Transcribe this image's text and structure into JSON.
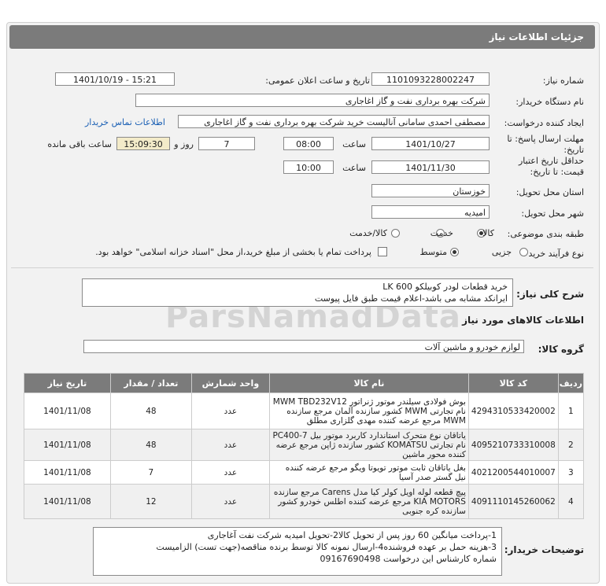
{
  "header": {
    "title": "جزئیات اطلاعات نیاز"
  },
  "fields": {
    "need_number_label": "شماره نیاز:",
    "need_number": "1101093228002247",
    "announce_label": "تاریخ و ساعت اعلان عمومی:",
    "announce_value": "1401/10/19 - 15:21",
    "buyer_label": "نام دستگاه خریدار:",
    "buyer_value": "شرکت بهره برداری نفت و گاز اغاجاری",
    "creator_label": "ایجاد کننده درخواست:",
    "creator_value": "مصطفی احمدی سامانی آنالیست خرید شرکت بهره برداری نفت و گاز اغاجاری",
    "contact_link": "اطلاعات تماس خریدار",
    "deadline_label_1": "مهلت ارسال پاسخ: تا",
    "deadline_label_2": "تاریخ:",
    "deadline_date": "1401/10/27",
    "time_label": "ساعت",
    "deadline_time": "08:00",
    "days_value": "7",
    "days_label": "روز و",
    "remaining_time": "15:09:30",
    "remaining_label": "ساعت باقی مانده",
    "validity_label_1": "حداقل تاریخ اعتبار",
    "validity_label_2": "قیمت: تا تاریخ:",
    "validity_date": "1401/11/30",
    "validity_time_label": "ساعت",
    "validity_time": "10:00",
    "province_label": "استان محل تحویل:",
    "province_value": "خوزستان",
    "city_label": "شهر محل تحویل:",
    "city_value": "امیدیه",
    "category_label": "طبقه بندی موضوعی:",
    "category_options": [
      "کالا",
      "خدمت",
      "کالا/خدمت"
    ],
    "process_label": "نوع فرآیند خرید :",
    "process_options": [
      "جزیی",
      "متوسط"
    ],
    "payment_note": "پرداخت تمام یا بخشی از مبلغ خرید،از محل \"اسناد خزانه اسلامی\" خواهد بود."
  },
  "summary": {
    "label": "شرح کلی نیاز:",
    "line1": "خرید قطعات لودر کوبیلکو LK 600",
    "line2": "ایرانکد مشابه می باشد-اعلام قیمت طبق فایل پیوست"
  },
  "goods_info_title": "اطلاعات کالاهای مورد نیاز",
  "goods_group": {
    "label": "گروه کالا:",
    "value": "لوازم خودرو و ماشین آلات"
  },
  "table": {
    "headers": [
      "ردیف",
      "کد کالا",
      "نام کالا",
      "واحد شمارش",
      "تعداد / مقدار",
      "تاریخ نیاز"
    ],
    "rows": [
      {
        "row": "1",
        "code": "4294310533420002",
        "name": "بوش فولادی سیلندر موتور ژنراتور MWM TBD232V12 نام تجارتی MWM کشور سازنده آلمان مرجع سازنده MWM مرجع عرضه کننده مهدی گلزاری مطلق",
        "unit": "عدد",
        "qty": "48",
        "date": "1401/11/08"
      },
      {
        "row": "2",
        "code": "4095210733310008",
        "name": "یاتاقان نوع متحرک استاندارد کاربرد موتور بیل PC400-7 نام تجارتی KOMATSU کشور سازنده ژاپن مرجع عرضه کننده محور ماشین",
        "unit": "عدد",
        "qty": "48",
        "date": "1401/11/08"
      },
      {
        "row": "3",
        "code": "4021200544010007",
        "name": "بغل یاتاقان ثابت موتور تویوتا ویگو مرجع عرضه کننده نیل گستر صدر آسیا",
        "unit": "عدد",
        "qty": "7",
        "date": "1401/11/08"
      },
      {
        "row": "4",
        "code": "4091110145260062",
        "name": "پیچ قطعه لوله اویل کولر کیا مدل Carens مرجع سازنده KIA MOTORS مرجع عرضه کننده اطلس خودرو کشور سازنده کره جنوبی",
        "unit": "عدد",
        "qty": "12",
        "date": "1401/11/08"
      }
    ]
  },
  "notes": {
    "label": "توضیحات خریدار:",
    "line1": "1-پرداخت میانگین 60 روز پس از تحویل کالا2-تحویل امیدیه شرکت نفت آغاجاری",
    "line2": "3-هزینه حمل بر عهده فروشنده4-ارسال نمونه کالا توسط برنده مناقصه(جهت تست) الزامیست",
    "line3": "شماره کارشناس این درخواست 09167690498"
  },
  "watermark": {
    "brand": "ParsNamadData"
  }
}
